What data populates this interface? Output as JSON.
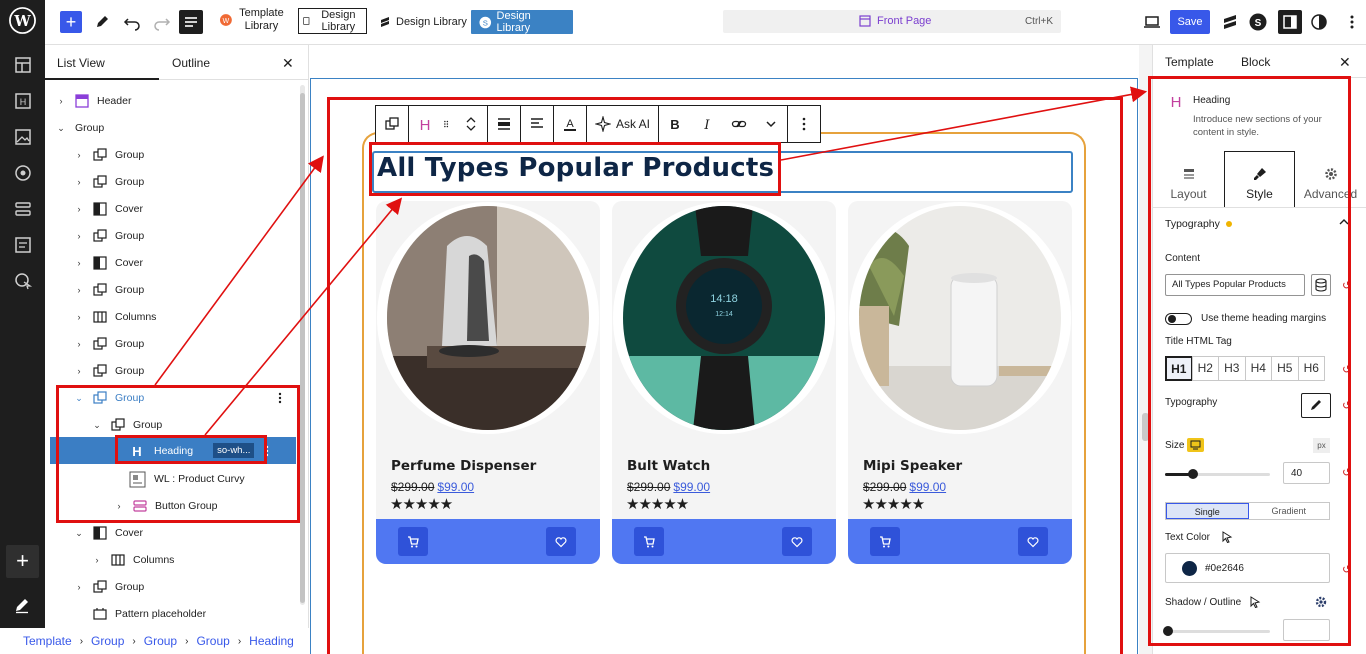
{
  "topbar": {
    "template_library_label": "Template Library",
    "design_library_boxed": "Design Library",
    "design_library_label": "Design Library",
    "design_library_active": "Design Library",
    "search_page": "Front Page",
    "search_shortcut": "Ctrl+K",
    "save_label": "Save"
  },
  "list_view": {
    "tab_list": "List View",
    "tab_outline": "Outline",
    "close": "✕",
    "rows": [
      {
        "label": "Header",
        "icon": "header-template-icon"
      },
      {
        "label": "Group",
        "icon": "none"
      },
      {
        "label": "Group",
        "icon": "group-icon"
      },
      {
        "label": "Group",
        "icon": "group-icon"
      },
      {
        "label": "Cover",
        "icon": "cover-icon"
      },
      {
        "label": "Group",
        "icon": "group-icon"
      },
      {
        "label": "Cover",
        "icon": "cover-icon"
      },
      {
        "label": "Group",
        "icon": "group-icon"
      },
      {
        "label": "Columns",
        "icon": "columns-icon"
      },
      {
        "label": "Group",
        "icon": "group-icon"
      },
      {
        "label": "Group",
        "icon": "group-icon"
      },
      {
        "label": "Group",
        "icon": "group-icon"
      },
      {
        "label": "Group",
        "icon": "group-icon"
      },
      {
        "label": "Heading",
        "icon": "heading-icon",
        "tag": "so-wh..."
      },
      {
        "label": "WL : Product Curvy",
        "icon": "product-curvy-icon"
      },
      {
        "label": "Button Group",
        "icon": "button-group-icon"
      },
      {
        "label": "Cover",
        "icon": "cover-icon"
      },
      {
        "label": "Columns",
        "icon": "columns-icon"
      },
      {
        "label": "Group",
        "icon": "group-icon"
      },
      {
        "label": "Pattern placeholder",
        "icon": "pattern-icon"
      }
    ]
  },
  "breadcrumb": [
    "Template",
    "Group",
    "Group",
    "Group",
    "Heading"
  ],
  "block_toolbar": {
    "ask_ai": "Ask AI"
  },
  "canvas": {
    "heading": "All Types Popular Products",
    "heading_color": "#0e2646",
    "products": [
      {
        "name": "Perfume Dispenser",
        "old_price": "$299.00",
        "new_price": "$99.00",
        "rating": 5,
        "stars": "★★★★★"
      },
      {
        "name": "Bult Watch",
        "old_price": "$299.00",
        "new_price": "$99.00",
        "rating": 5,
        "stars": "★★★★★"
      },
      {
        "name": "Mipi Speaker",
        "old_price": "$299.00",
        "new_price": "$99.00",
        "rating": 5,
        "stars": "★★★★★"
      }
    ]
  },
  "sidebar": {
    "tab_template": "Template",
    "tab_block": "Block",
    "close": "✕",
    "block_name": "Heading",
    "block_desc": "Introduce new sections of your content in style.",
    "tabs": [
      "Layout",
      "Style",
      "Advanced"
    ],
    "typography_section": "Typography",
    "content_label": "Content",
    "content_value": "All Types Popular Products",
    "theme_margins_label": "Use theme heading margins",
    "html_tag_label": "Title HTML Tag",
    "html_tags": [
      "H1",
      "H2",
      "H3",
      "H4",
      "H5",
      "H6"
    ],
    "typography_label": "Typography",
    "size_label": "Size",
    "size_unit": "px",
    "size_value": "40",
    "size_slider_fraction": 0.27,
    "fill_single": "Single",
    "fill_gradient": "Gradient",
    "text_color_label": "Text Color",
    "text_color_value": "#0e2646",
    "shadow_label": "Shadow / Outline"
  }
}
